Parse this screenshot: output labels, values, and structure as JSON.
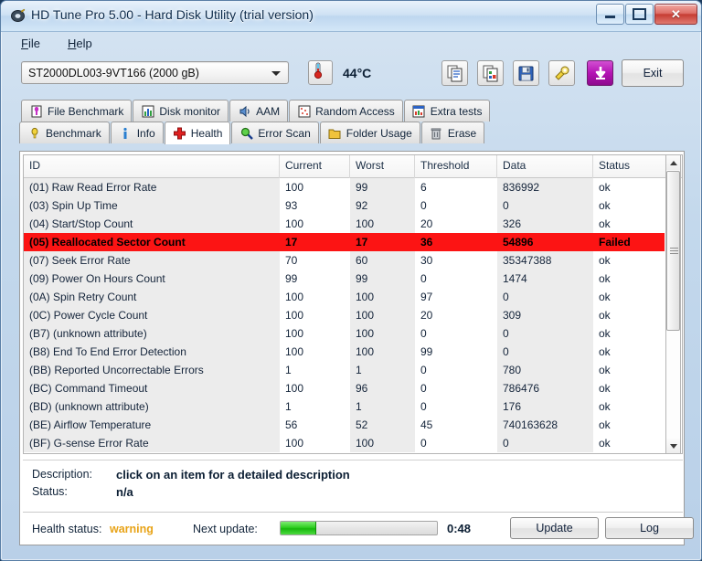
{
  "window": {
    "title": "HD Tune Pro 5.00 - Hard Disk Utility (trial version)",
    "icon": "hdtune-logo-icon",
    "controls": {
      "minimize": "minimize-button",
      "maximize": "maximize-button",
      "close": "✕"
    }
  },
  "menubar": {
    "items": [
      {
        "label": "File",
        "mnemonic": "F"
      },
      {
        "label": "Help",
        "mnemonic": "H"
      }
    ]
  },
  "toolbar": {
    "drive": {
      "selected": "ST2000DL003-9VT166 (2000 gB)",
      "options": [
        "ST2000DL003-9VT166 (2000 gB)"
      ]
    },
    "temperature": "44°C",
    "temperature_icon": "thermometer-icon",
    "buttons": [
      {
        "name": "copy-text-icon",
        "title": "Copy"
      },
      {
        "name": "copy-image-icon",
        "title": "Copy screenshot"
      },
      {
        "name": "save-icon",
        "title": "Save"
      },
      {
        "name": "settings-icon",
        "title": "Options"
      },
      {
        "name": "download-arrow-icon",
        "title": "Download"
      }
    ],
    "exit_label": "Exit"
  },
  "tabs": {
    "row1": [
      {
        "label": "File Benchmark",
        "icon": "file-benchmark-icon",
        "active": false
      },
      {
        "label": "Disk monitor",
        "icon": "disk-monitor-icon",
        "active": false
      },
      {
        "label": "AAM",
        "icon": "speaker-icon",
        "active": false
      },
      {
        "label": "Random Access",
        "icon": "random-access-icon",
        "active": false
      },
      {
        "label": "Extra tests",
        "icon": "extra-tests-icon",
        "active": false
      }
    ],
    "row2": [
      {
        "label": "Benchmark",
        "icon": "benchmark-icon",
        "active": false
      },
      {
        "label": "Info",
        "icon": "info-icon",
        "active": false
      },
      {
        "label": "Health",
        "icon": "health-cross-icon",
        "active": true
      },
      {
        "label": "Error Scan",
        "icon": "magnifier-icon",
        "active": false
      },
      {
        "label": "Folder Usage",
        "icon": "folder-icon",
        "active": false
      },
      {
        "label": "Erase",
        "icon": "trash-icon",
        "active": false
      }
    ]
  },
  "table": {
    "columns": [
      "ID",
      "Current",
      "Worst",
      "Threshold",
      "Data",
      "Status"
    ],
    "rows": [
      {
        "id": "(01) Raw Read Error Rate",
        "current": "100",
        "worst": "99",
        "threshold": "6",
        "data": "836992",
        "status": "ok",
        "failed": false
      },
      {
        "id": "(03) Spin Up Time",
        "current": "93",
        "worst": "92",
        "threshold": "0",
        "data": "0",
        "status": "ok",
        "failed": false
      },
      {
        "id": "(04) Start/Stop Count",
        "current": "100",
        "worst": "100",
        "threshold": "20",
        "data": "326",
        "status": "ok",
        "failed": false
      },
      {
        "id": "(05) Reallocated Sector Count",
        "current": "17",
        "worst": "17",
        "threshold": "36",
        "data": "54896",
        "status": "Failed",
        "failed": true
      },
      {
        "id": "(07) Seek Error Rate",
        "current": "70",
        "worst": "60",
        "threshold": "30",
        "data": "35347388",
        "status": "ok",
        "failed": false
      },
      {
        "id": "(09) Power On Hours Count",
        "current": "99",
        "worst": "99",
        "threshold": "0",
        "data": "1474",
        "status": "ok",
        "failed": false
      },
      {
        "id": "(0A) Spin Retry Count",
        "current": "100",
        "worst": "100",
        "threshold": "97",
        "data": "0",
        "status": "ok",
        "failed": false
      },
      {
        "id": "(0C) Power Cycle Count",
        "current": "100",
        "worst": "100",
        "threshold": "20",
        "data": "309",
        "status": "ok",
        "failed": false
      },
      {
        "id": "(B7) (unknown attribute)",
        "current": "100",
        "worst": "100",
        "threshold": "0",
        "data": "0",
        "status": "ok",
        "failed": false
      },
      {
        "id": "(B8) End To End Error Detection",
        "current": "100",
        "worst": "100",
        "threshold": "99",
        "data": "0",
        "status": "ok",
        "failed": false
      },
      {
        "id": "(BB) Reported Uncorrectable Errors",
        "current": "1",
        "worst": "1",
        "threshold": "0",
        "data": "780",
        "status": "ok",
        "failed": false
      },
      {
        "id": "(BC) Command Timeout",
        "current": "100",
        "worst": "96",
        "threshold": "0",
        "data": "786476",
        "status": "ok",
        "failed": false
      },
      {
        "id": "(BD) (unknown attribute)",
        "current": "1",
        "worst": "1",
        "threshold": "0",
        "data": "176",
        "status": "ok",
        "failed": false
      },
      {
        "id": "(BE) Airflow Temperature",
        "current": "56",
        "worst": "52",
        "threshold": "45",
        "data": "740163628",
        "status": "ok",
        "failed": false
      },
      {
        "id": "(BF) G-sense Error Rate",
        "current": "100",
        "worst": "100",
        "threshold": "0",
        "data": "0",
        "status": "ok",
        "failed": false
      }
    ]
  },
  "details": {
    "description_label": "Description:",
    "description_value": "click on an item for a detailed description",
    "status_label": "Status:",
    "status_value": "n/a"
  },
  "statusbar": {
    "health_label": "Health status:",
    "health_value": "warning",
    "health_color": "#e8a317",
    "next_update_label": "Next update:",
    "progress_percent": 22,
    "time_remaining": "0:48",
    "update_label": "Update",
    "log_label": "Log"
  }
}
